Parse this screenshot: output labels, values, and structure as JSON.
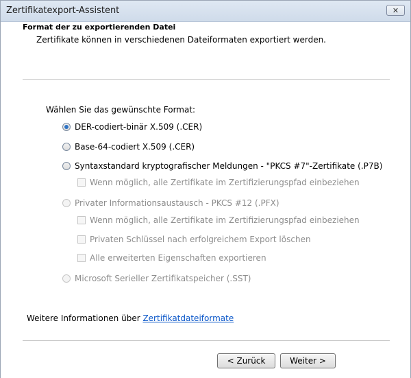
{
  "window": {
    "title": "Zertifikatexport-Assistent",
    "close_glyph": "✕"
  },
  "header": {
    "title": "Format der zu exportierenden Datei",
    "subtitle": "Zertifikate können in verschiedenen Dateiformaten exportiert werden."
  },
  "body": {
    "choose_label": "Wählen Sie das gewünschte Format:",
    "options": {
      "der": {
        "label": "DER-codiert-binär X.509 (.CER)",
        "selected": true,
        "enabled": true
      },
      "base64": {
        "label": "Base-64-codiert X.509 (.CER)",
        "selected": false,
        "enabled": true
      },
      "pkcs7": {
        "label": "Syntaxstandard kryptografischer Meldungen - \"PKCS #7\"-Zertifikate (.P7B)",
        "selected": false,
        "enabled": true
      },
      "pkcs7_include_chain": {
        "label": "Wenn möglich, alle Zertifikate im Zertifizierungspfad einbeziehen",
        "checked": false,
        "enabled": false
      },
      "pfx": {
        "label": "Privater Informationsaustausch - PKCS #12 (.PFX)",
        "selected": false,
        "enabled": false
      },
      "pfx_include_chain": {
        "label": "Wenn möglich, alle Zertifikate im Zertifizierungspfad einbeziehen",
        "checked": false,
        "enabled": false
      },
      "pfx_delete_key": {
        "label": "Privaten Schlüssel nach erfolgreichem Export löschen",
        "checked": false,
        "enabled": false
      },
      "pfx_export_props": {
        "label": "Alle erweiterten Eigenschaften exportieren",
        "checked": false,
        "enabled": false
      },
      "sst": {
        "label": "Microsoft Serieller Zertifikatspeicher (.SST)",
        "selected": false,
        "enabled": false
      }
    }
  },
  "footer": {
    "info_prefix": "Weitere Informationen über ",
    "info_link": "Zertifikatdateiformate",
    "back_button": "< Zurück",
    "next_button": "Weiter >"
  },
  "colors": {
    "link": "#0b57c9",
    "radio_selected": "#2d72c4",
    "disabled_text": "#8d8d8d"
  }
}
